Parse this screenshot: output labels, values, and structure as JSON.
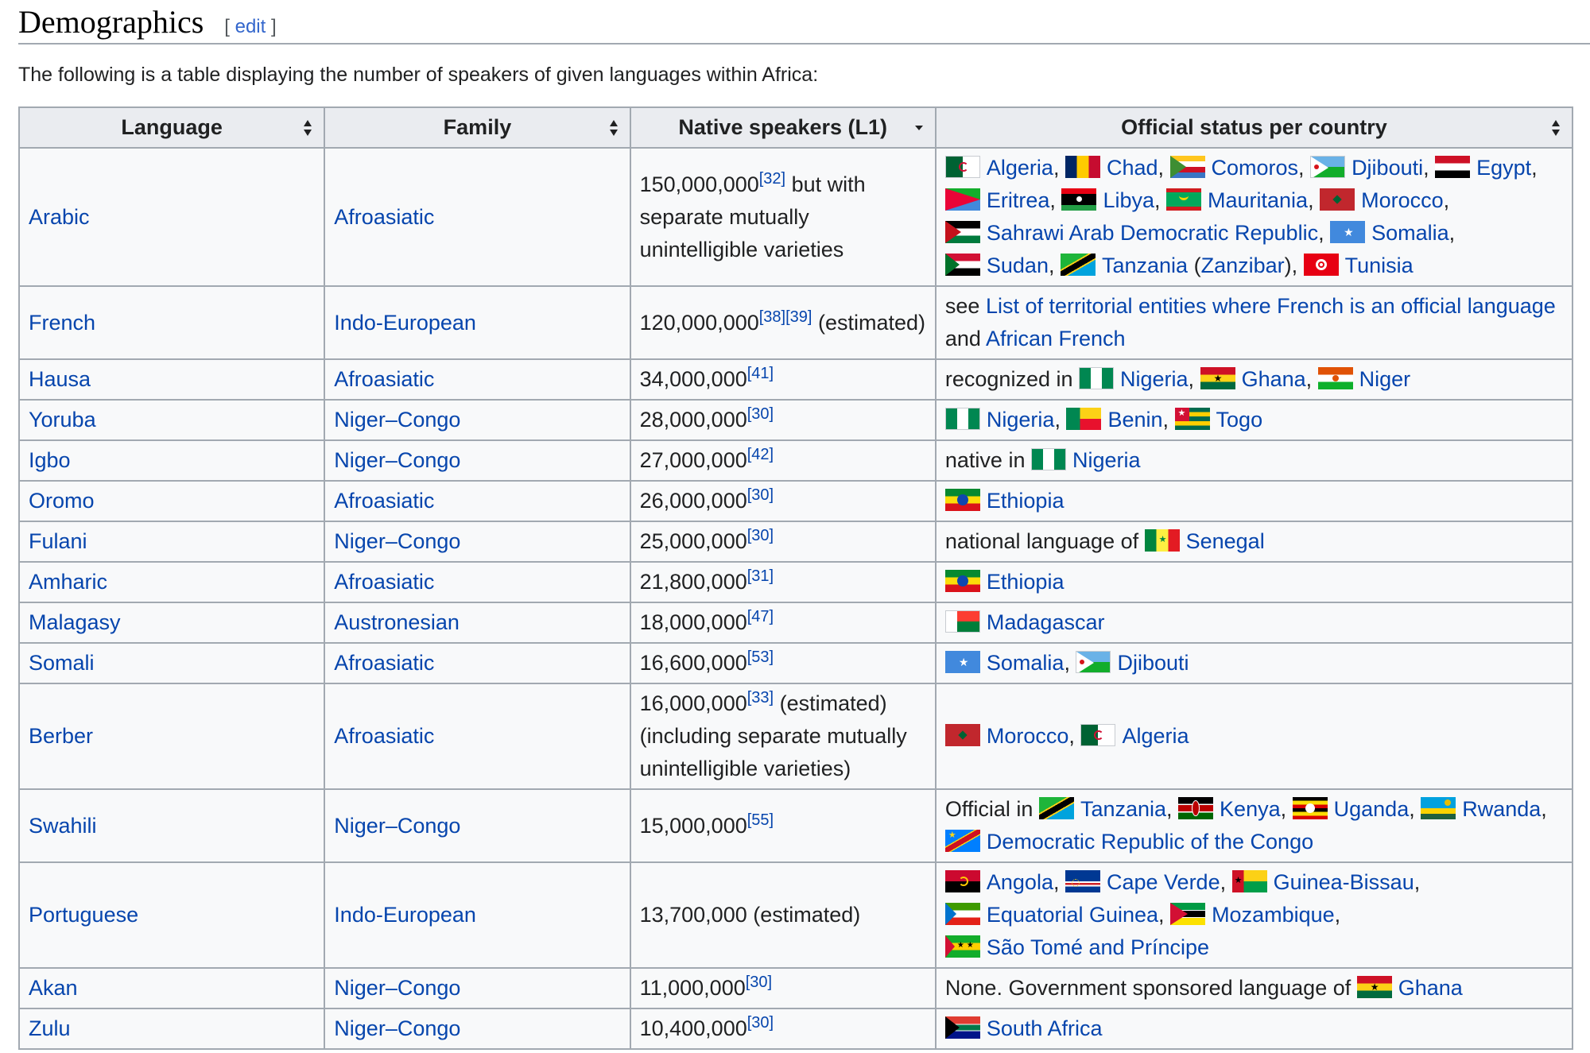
{
  "heading": {
    "title": "Demographics",
    "edit_open": "[ ",
    "edit_label": "edit",
    "edit_close": " ]"
  },
  "intro": "The following is a table displaying the number of speakers of given languages within Africa:",
  "table": {
    "headers": [
      "Language",
      "Family",
      "Native speakers (L1)",
      "Official status per country"
    ],
    "rows": [
      {
        "language": "Arabic",
        "family": "Afroasiatic",
        "speakers": "150,000,000",
        "refs": [
          "[32]"
        ],
        "note": " but with separate mutually unintelligible varieties",
        "status": [
          {
            "flag": "algeria",
            "name": "Algeria",
            "sep": ", "
          },
          {
            "flag": "chad",
            "name": "Chad",
            "sep": ", "
          },
          {
            "flag": "comoros",
            "name": "Comoros",
            "sep": ", "
          },
          {
            "flag": "djibouti",
            "name": "Djibouti",
            "sep": ", "
          },
          {
            "flag": "egypt",
            "name": "Egypt",
            "sep": ", "
          },
          {
            "flag": "eritrea",
            "name": "Eritrea",
            "sep": ", "
          },
          {
            "flag": "libya",
            "name": "Libya",
            "sep": ", "
          },
          {
            "flag": "mauritania",
            "name": "Mauritania",
            "sep": ", "
          },
          {
            "flag": "morocco",
            "name": "Morocco",
            "sep": ", "
          },
          {
            "flag": "sahrawi",
            "name": "Sahrawi Arab Democratic Republic",
            "sep": ", "
          },
          {
            "flag": "somalia",
            "name": "Somalia",
            "sep": ", "
          },
          {
            "flag": "sudan",
            "name": "Sudan",
            "sep": ", "
          },
          {
            "flag": "tanzania",
            "name": "Tanzania",
            "sep": " (",
            "link2": "Zanzibar",
            "sep2": "), "
          },
          {
            "flag": "tunisia",
            "name": "Tunisia",
            "sep": ""
          }
        ]
      },
      {
        "language": "French",
        "family": "Indo-European",
        "speakers": "120,000,000",
        "refs": [
          "[38]",
          "[39]"
        ],
        "note": " (estimated)",
        "status_prefix": "see ",
        "status": [
          {
            "name": "List of territorial entities where French is an official language",
            "sep": " and "
          },
          {
            "name": "African French",
            "sep": ""
          }
        ]
      },
      {
        "language": "Hausa",
        "family": "Afroasiatic",
        "speakers": "34,000,000",
        "refs": [
          "[41]"
        ],
        "note": "",
        "status_prefix": "recognized in ",
        "status": [
          {
            "flag": "nigeria",
            "name": "Nigeria",
            "sep": ", "
          },
          {
            "flag": "ghana",
            "name": "Ghana",
            "sep": ", "
          },
          {
            "flag": "niger",
            "name": "Niger",
            "sep": ""
          }
        ]
      },
      {
        "language": "Yoruba",
        "family": "Niger–Congo",
        "speakers": "28,000,000",
        "refs": [
          "[30]"
        ],
        "note": "",
        "status": [
          {
            "flag": "nigeria",
            "name": "Nigeria",
            "sep": ", "
          },
          {
            "flag": "benin",
            "name": "Benin",
            "sep": ", "
          },
          {
            "flag": "togo",
            "name": "Togo",
            "sep": ""
          }
        ]
      },
      {
        "language": "Igbo",
        "family": "Niger–Congo",
        "speakers": "27,000,000",
        "refs": [
          "[42]"
        ],
        "note": "",
        "status_prefix": "native in ",
        "status": [
          {
            "flag": "nigeria",
            "name": "Nigeria",
            "sep": ""
          }
        ]
      },
      {
        "language": "Oromo",
        "family": "Afroasiatic",
        "speakers": "26,000,000",
        "refs": [
          "[30]"
        ],
        "note": "",
        "status": [
          {
            "flag": "ethiopia",
            "name": "Ethiopia",
            "sep": ""
          }
        ]
      },
      {
        "language": "Fulani",
        "family": "Niger–Congo",
        "speakers": "25,000,000",
        "refs": [
          "[30]"
        ],
        "note": "",
        "status_prefix": "national language of ",
        "status": [
          {
            "flag": "senegal",
            "name": "Senegal",
            "sep": ""
          }
        ]
      },
      {
        "language": "Amharic",
        "family": "Afroasiatic",
        "speakers": "21,800,000",
        "refs": [
          "[31]"
        ],
        "note": "",
        "status": [
          {
            "flag": "ethiopia",
            "name": "Ethiopia",
            "sep": ""
          }
        ]
      },
      {
        "language": "Malagasy",
        "family": "Austronesian",
        "speakers": "18,000,000",
        "refs": [
          "[47]"
        ],
        "note": "",
        "status": [
          {
            "flag": "madagascar",
            "name": "Madagascar",
            "sep": ""
          }
        ]
      },
      {
        "language": "Somali",
        "family": "Afroasiatic",
        "speakers": "16,600,000",
        "refs": [
          "[53]"
        ],
        "note": "",
        "status": [
          {
            "flag": "somalia",
            "name": "Somalia",
            "sep": ", "
          },
          {
            "flag": "djibouti",
            "name": "Djibouti",
            "sep": ""
          }
        ]
      },
      {
        "language": "Berber",
        "family": "Afroasiatic",
        "speakers": "16,000,000",
        "refs": [
          "[33]"
        ],
        "note": " (estimated) (including separate mutually unintelligible varieties)",
        "status": [
          {
            "flag": "morocco",
            "name": "Morocco",
            "sep": ", "
          },
          {
            "flag": "algeria",
            "name": "Algeria",
            "sep": ""
          }
        ]
      },
      {
        "language": "Swahili",
        "family": "Niger–Congo",
        "speakers": "15,000,000",
        "refs": [
          "[55]"
        ],
        "note": "",
        "status_prefix": "Official in ",
        "status": [
          {
            "flag": "tanzania",
            "name": "Tanzania",
            "sep": ", "
          },
          {
            "flag": "kenya",
            "name": "Kenya",
            "sep": ", "
          },
          {
            "flag": "uganda",
            "name": "Uganda",
            "sep": ", "
          },
          {
            "flag": "rwanda",
            "name": "Rwanda",
            "sep": ", "
          },
          {
            "flag": "drc",
            "name": "Democratic Republic of the Congo",
            "sep": ""
          }
        ]
      },
      {
        "language": "Portuguese",
        "family": "Indo-European",
        "speakers": "13,700,000",
        "refs": [],
        "note": " (estimated)",
        "status": [
          {
            "flag": "angola",
            "name": "Angola",
            "sep": ", "
          },
          {
            "flag": "capeverde",
            "name": "Cape Verde",
            "sep": ", "
          },
          {
            "flag": "guineabissau",
            "name": "Guinea-Bissau",
            "sep": ", "
          },
          {
            "flag": "eqguinea",
            "name": "Equatorial Guinea",
            "sep": ", "
          },
          {
            "flag": "mozambique",
            "name": "Mozambique",
            "sep": ", "
          },
          {
            "flag": "saotome",
            "name": "São Tomé and Príncipe",
            "sep": ""
          }
        ]
      },
      {
        "language": "Akan",
        "family": "Niger–Congo",
        "speakers": "11,000,000",
        "refs": [
          "[30]"
        ],
        "note": "",
        "status_prefix": "None. Government sponsored language of ",
        "status": [
          {
            "flag": "ghana",
            "name": "Ghana",
            "sep": ""
          }
        ]
      },
      {
        "language": "Zulu",
        "family": "Niger–Congo",
        "speakers": "10,400,000",
        "refs": [
          "[30]"
        ],
        "note": "",
        "status": [
          {
            "flag": "southafrica",
            "name": "South Africa",
            "sep": ""
          }
        ]
      }
    ]
  },
  "colors": {
    "link": "#0645ad",
    "header_bg": "#eaecf0",
    "cell_bg": "#f8f9fa",
    "border": "#a2a9b1"
  }
}
